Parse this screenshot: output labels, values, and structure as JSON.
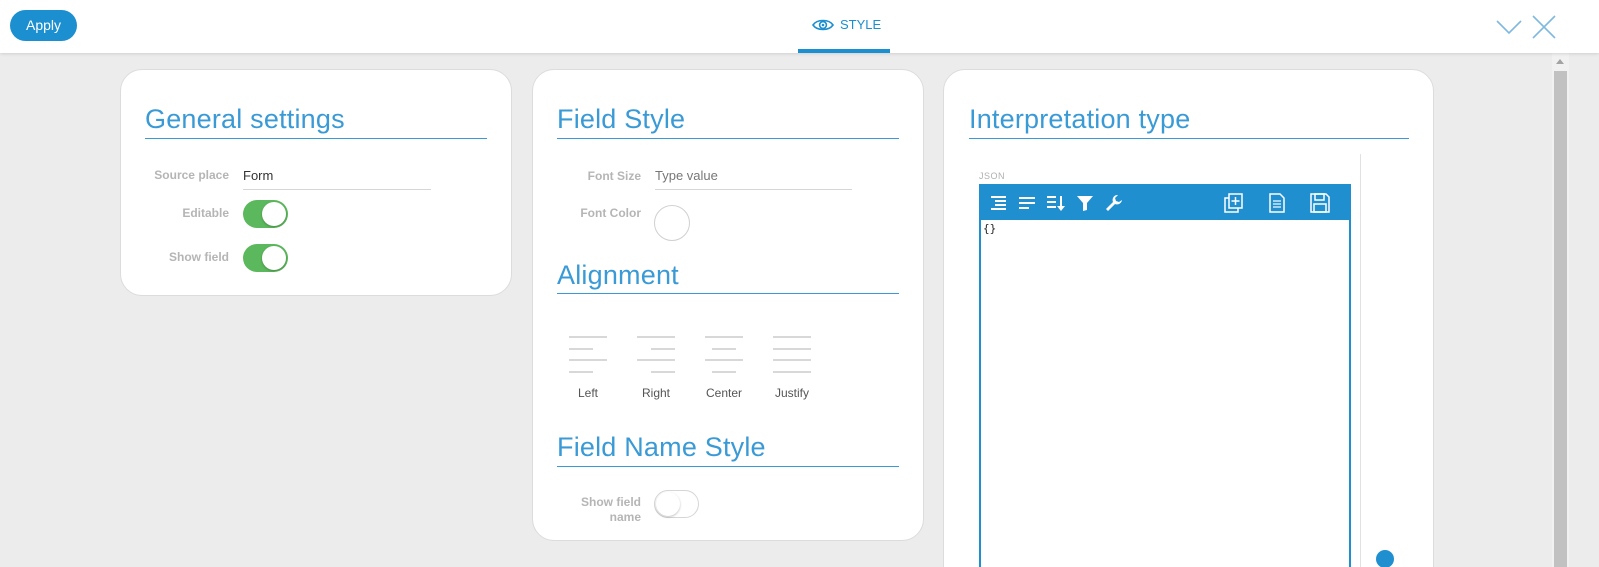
{
  "header": {
    "apply_label": "Apply",
    "tab_label": "STYLE",
    "tab_icon": "eye-icon",
    "right_icons": [
      "chevron-down-icon",
      "close-icon"
    ],
    "accent_color": "#1b8fd0"
  },
  "general_settings": {
    "title": "General settings",
    "source_place": {
      "label": "Source place",
      "value": "Form"
    },
    "editable": {
      "label": "Editable",
      "on": true
    },
    "show_field": {
      "label": "Show field",
      "on": true
    }
  },
  "field_style": {
    "title": "Field Style",
    "font_size": {
      "label": "Font Size",
      "placeholder": "Type value"
    },
    "font_color": {
      "label": "Font Color",
      "value": "#ffffff"
    },
    "alignment": {
      "title": "Alignment",
      "options": [
        "Left",
        "Right",
        "Center",
        "Justify"
      ]
    },
    "field_name_style": {
      "title": "Field Name Style",
      "show_field_name": {
        "label_line1": "Show field",
        "label_line2": "name",
        "on": false
      }
    }
  },
  "interpretation": {
    "title": "Interpretation type",
    "editor_label": "JSON",
    "toolbar_icons": [
      "format-icon",
      "compact-icon",
      "sort-icon",
      "filter-icon",
      "wrench-icon",
      "duplicate-icon",
      "document-icon",
      "save-icon"
    ],
    "content": "{}"
  }
}
